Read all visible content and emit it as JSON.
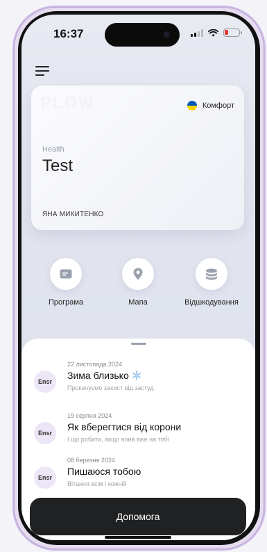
{
  "status_bar": {
    "time": "16:37"
  },
  "card": {
    "watermark": "PLOW",
    "tier": "Комфорт",
    "category": "Health",
    "title": "Test",
    "holder": "ЯНА МИКИТЕНКО"
  },
  "actions": [
    {
      "label": "Програма",
      "icon": "card-icon"
    },
    {
      "label": "Мапа",
      "icon": "map-pin-icon"
    },
    {
      "label": "Відшкодування",
      "icon": "coins-stack-icon"
    }
  ],
  "news": [
    {
      "avatar": "Ensr",
      "date": "22 листопада 2024",
      "title": "Зима близько",
      "icon": "snowflake-icon",
      "subtitle": "Прокачуємо захист від застуд"
    },
    {
      "avatar": "Ensr",
      "date": "19 серпня 2024",
      "title": "Як вберегтися від корони",
      "subtitle": "І що робити, якщо вона вже на тобі"
    },
    {
      "avatar": "Ensr",
      "date": "08 березня 2024",
      "title": "Пишаюся тобою",
      "subtitle": "Вітання всім і кожній"
    }
  ],
  "help_button": {
    "label": "Допомога"
  },
  "colors": {
    "accent": "#202122",
    "avatar_bg": "#ece6f7",
    "flag_blue": "#0057b7",
    "flag_yellow": "#ffd700"
  }
}
